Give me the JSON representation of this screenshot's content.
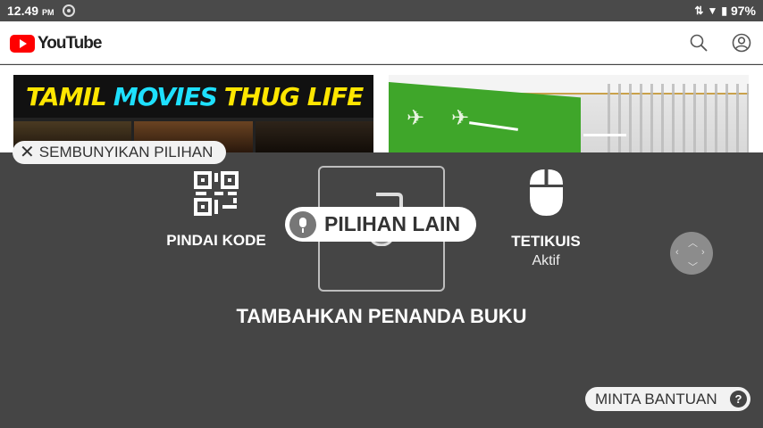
{
  "status_bar": {
    "time": "12.49",
    "ampm": "PM",
    "battery": "97%"
  },
  "youtube": {
    "logo_text": "YouTube",
    "brand_color": "#FF0000"
  },
  "thumbnails": [
    {
      "text_words": [
        "TAMIL",
        "MOVIES",
        "THUG LIFE"
      ]
    },
    {
      "description": ""
    }
  ],
  "overlay": {
    "hide_options": "SEMBUNYIKAN PILIHAN",
    "options": [
      {
        "label": "PINDAI KODE",
        "icon": "qr-code-icon"
      },
      {
        "label": "TETIKUIS",
        "sub": "Aktif",
        "icon": "mouse-icon"
      }
    ],
    "more_options": "PILIHAN LAIN",
    "selected_option": "TAMBAHKAN PENANDA BUKU",
    "help": "MINTA BANTUAN",
    "help_icon": "?"
  },
  "colors": {
    "panel_bg": "#454545",
    "status_bg": "#4a4a4a"
  }
}
